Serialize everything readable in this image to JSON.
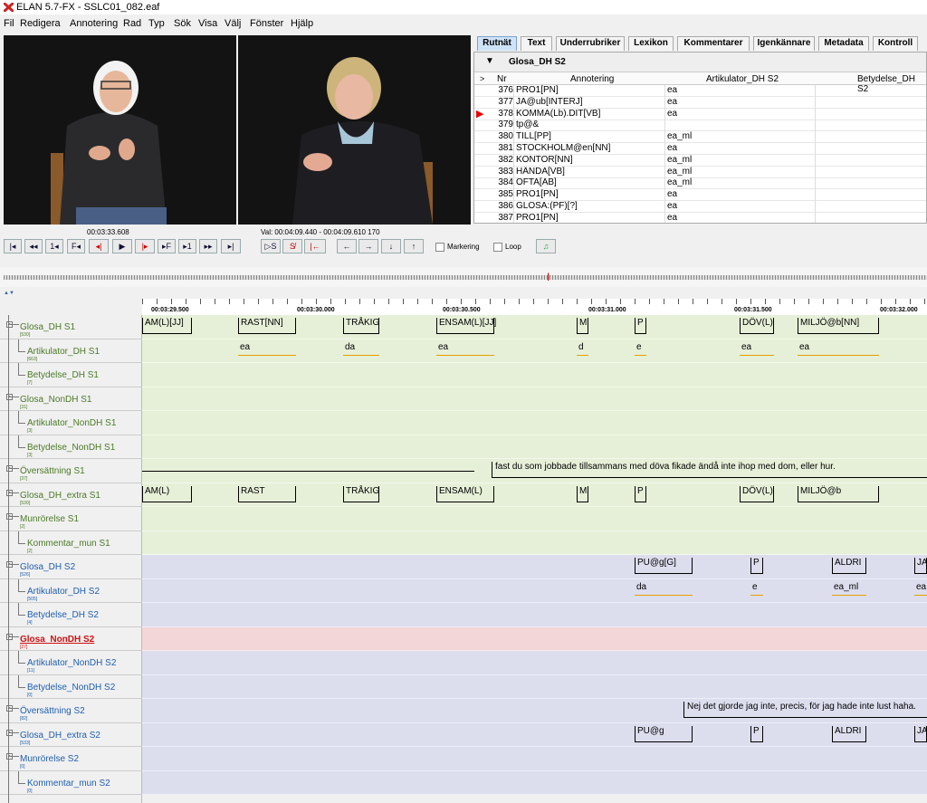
{
  "window": {
    "title": "ELAN 5.7-FX - SSLC01_082.eaf"
  },
  "menu": [
    "Fil",
    "Redigera",
    "Annotering",
    "Rad",
    "Typ",
    "Sök",
    "Visa",
    "Välj",
    "Fönster",
    "Hjälp"
  ],
  "video": {
    "time": "00:03:33.608",
    "selection": "Val: 00:04:09.440 - 00:04:09.610  170"
  },
  "controls": {
    "marking_label": "Markering",
    "loop_label": "Loop"
  },
  "tabs": [
    "Rutnät",
    "Text",
    "Underrubriker",
    "Lexikon",
    "Kommentarer",
    "Igenkännare",
    "Metadata",
    "Kontroll"
  ],
  "grid": {
    "tier": "Glosa_DH S2",
    "columns": [
      "Nr",
      "Annotering",
      "Artikulator_DH S2",
      "Betydelse_DH S2"
    ],
    "rows": [
      {
        "nr": "376",
        "ann": "PRO1[PN]",
        "art": "ea"
      },
      {
        "nr": "377",
        "ann": "JA@ub[INTERJ]",
        "art": "ea"
      },
      {
        "nr": "378",
        "ann": "KOMMA(Lb).DIT[VB]",
        "art": "ea"
      },
      {
        "nr": "379",
        "ann": "tp@&",
        "art": ""
      },
      {
        "nr": "380",
        "ann": "TILL[PP]",
        "art": "ea_ml"
      },
      {
        "nr": "381",
        "ann": "STOCKHOLM@en[NN]",
        "art": "ea"
      },
      {
        "nr": "382",
        "ann": "KONTOR[NN]",
        "art": "ea_ml"
      },
      {
        "nr": "383",
        "ann": "HÄNDA[VB]",
        "art": "ea_ml"
      },
      {
        "nr": "384",
        "ann": "OFTA[AB]",
        "art": "ea_ml"
      },
      {
        "nr": "385",
        "ann": "PRO1[PN]",
        "art": "ea"
      },
      {
        "nr": "386",
        "ann": "GLOSA:(PF)[?]",
        "art": "ea"
      },
      {
        "nr": "387",
        "ann": "PRO1[PN]",
        "art": "ea"
      }
    ]
  },
  "ruler": [
    "00:03:29.500",
    "00:03:30.000",
    "00:03:30.500",
    "00:03:31.000",
    "00:03:31.500",
    "00:03:32.000"
  ],
  "tiers": [
    {
      "name": "Glosa_DH S1",
      "count": "[530]"
    },
    {
      "name": "Artikulator_DH S1",
      "count": "[663]"
    },
    {
      "name": "Betydelse_DH S1",
      "count": "[7]"
    },
    {
      "name": "Glosa_NonDH S1",
      "count": "[31]"
    },
    {
      "name": "Artikulator_NonDH S1",
      "count": "[3]"
    },
    {
      "name": "Betydelse_NonDH S1",
      "count": "[3]"
    },
    {
      "name": "Översättning S1",
      "count": "[37]"
    },
    {
      "name": "Glosa_DH_extra S1",
      "count": "[530]"
    },
    {
      "name": "Munrörelse S1",
      "count": "[2]"
    },
    {
      "name": "Kommentar_mun S1",
      "count": "[2]"
    },
    {
      "name": "Glosa_DH S2",
      "count": "[526]"
    },
    {
      "name": "Artikulator_DH S2",
      "count": "[505]"
    },
    {
      "name": "Betydelse_DH S2",
      "count": "[4]"
    },
    {
      "name": "Glosa_NonDH S2",
      "count": "[27]"
    },
    {
      "name": "Artikulator_NonDH S2",
      "count": "[11]"
    },
    {
      "name": "Betydelse_NonDH S2",
      "count": "[0]"
    },
    {
      "name": "Översättning S2",
      "count": "[82]"
    },
    {
      "name": "Glosa_DH_extra S2",
      "count": "[533]"
    },
    {
      "name": "Munrörelse S2",
      "count": "[0]"
    },
    {
      "name": "Kommentar_mun S2",
      "count": "[0]"
    }
  ],
  "annotations": {
    "glosa_dh_s1": [
      "AM(L)[JJ]",
      "RAST[NN]",
      "TRÅKIG",
      "ENSAM(L)[JJ]",
      "M",
      "P",
      "DÖV(L)",
      "MILJÖ@b[NN]"
    ],
    "art_dh_s1": [
      "ea",
      "da",
      "ea",
      "d",
      "e",
      "ea",
      "ea"
    ],
    "translation_s1": "fast du som jobbade tillsammans med döva fikade ändå inte ihop med dom, eller hur.",
    "extra_s1": [
      "AM(L)",
      "RAST",
      "TRÅKIG",
      "ENSAM(L)",
      "M",
      "P",
      "DÖV(L)",
      "MILJÖ@b"
    ],
    "glosa_dh_s2": [
      "PU@g[G]",
      "P",
      "ALDRI",
      "JA"
    ],
    "art_dh_s2": [
      "da",
      "e",
      "ea_ml",
      "ea"
    ],
    "translation_s2": "Nej det gjorde jag inte, precis,  för jag hade inte lust haha.",
    "extra_s2": [
      "PU@g",
      "P",
      "ALDRI",
      "JA"
    ]
  },
  "colors": {
    "s1_bg": "#e6f0d8",
    "s2_bg": "#dcdeee",
    "active_bg": "#f2d6d8",
    "s1_text": "#4b7a26",
    "s2_text": "#1f5fae",
    "active_text": "#d01010"
  }
}
